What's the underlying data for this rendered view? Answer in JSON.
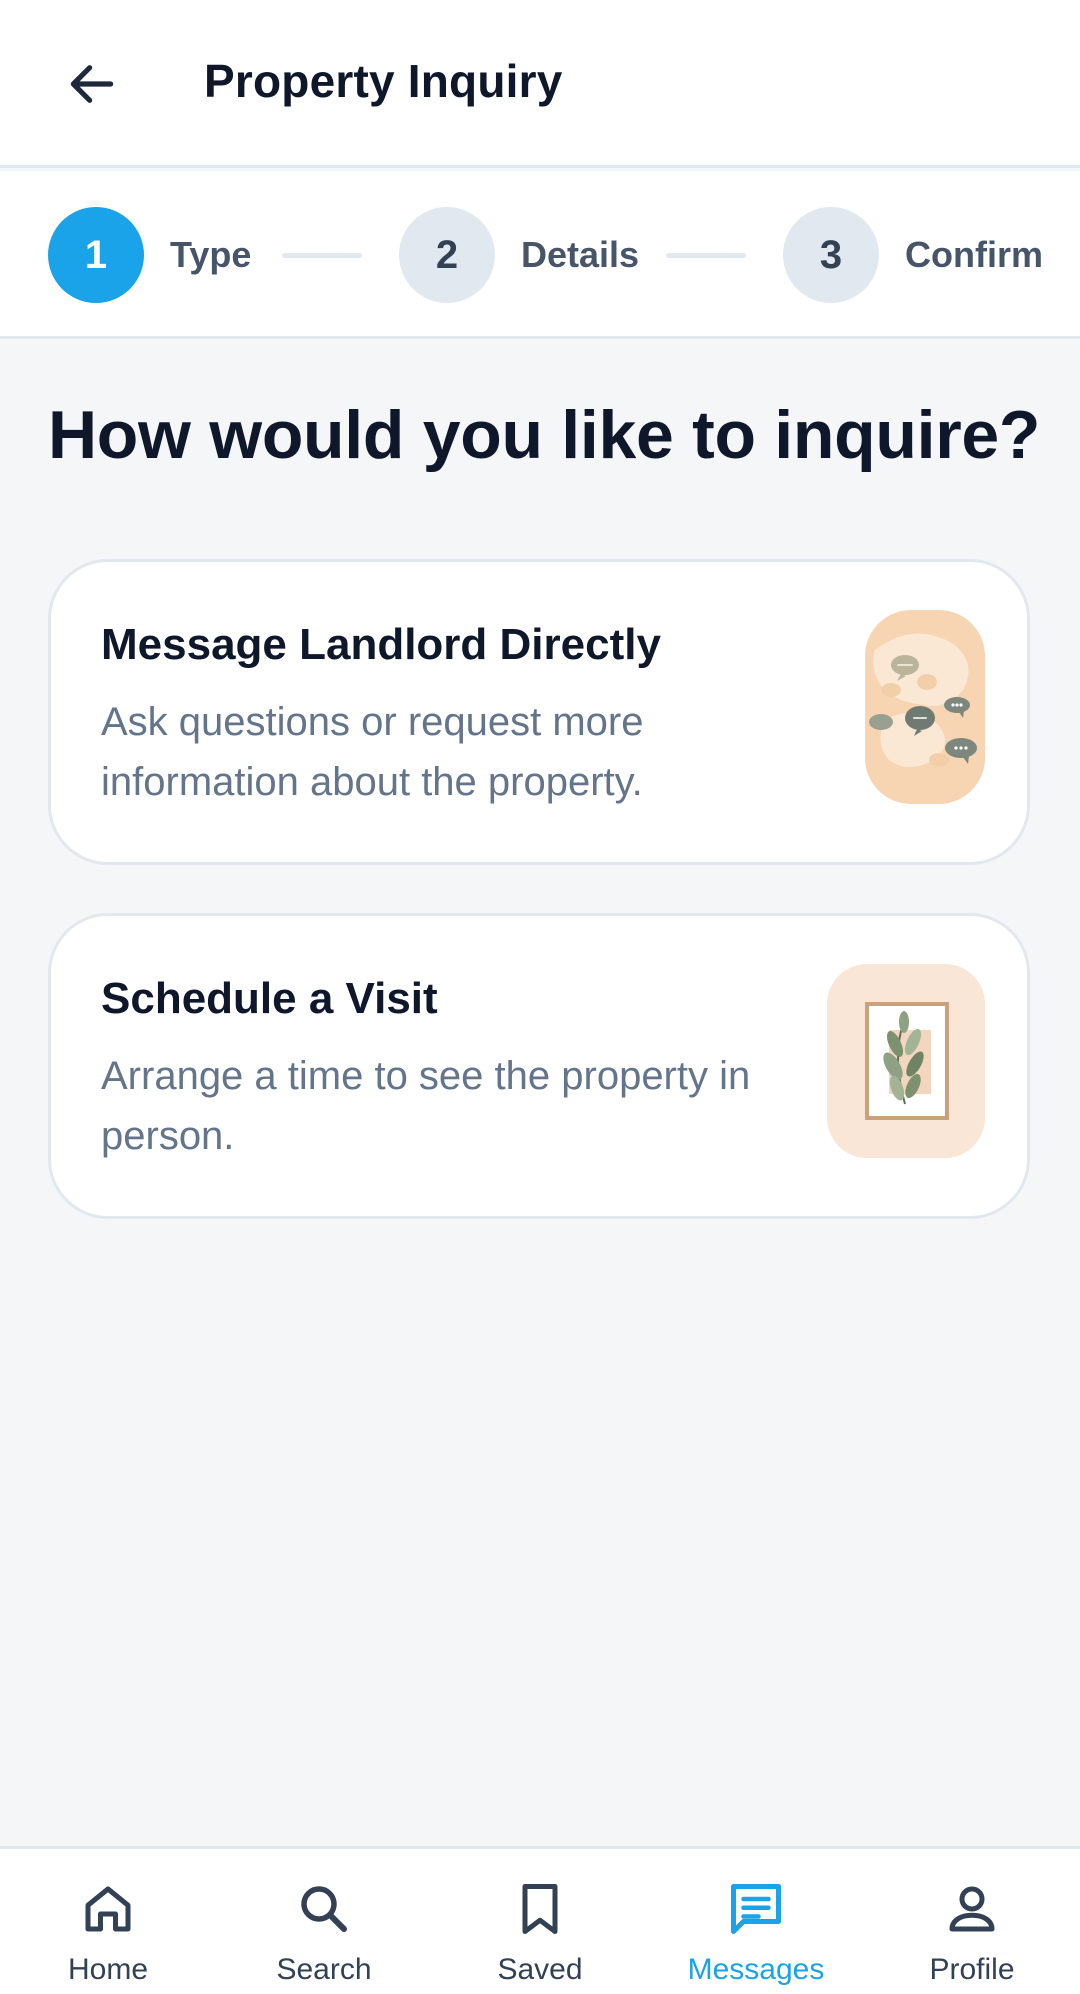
{
  "header": {
    "title": "Property Inquiry",
    "back_icon": "arrow-left-icon"
  },
  "stepper": {
    "steps": [
      {
        "number": "1",
        "label": "Type",
        "state": "active"
      },
      {
        "number": "2",
        "label": "Details",
        "state": "inactive"
      },
      {
        "number": "3",
        "label": "Confirm",
        "state": "inactive"
      }
    ]
  },
  "main": {
    "question": "How would you like to inquire?",
    "options": [
      {
        "title": "Message Landlord Directly",
        "description": "Ask questions or request more information about the property.",
        "icon": "chat-bubbles-illustration"
      },
      {
        "title": "Schedule a Visit",
        "description": "Arrange a time to see the property in person.",
        "icon": "framed-plant-illustration"
      }
    ]
  },
  "bottom_nav": {
    "items": [
      {
        "label": "Home",
        "icon": "home-icon",
        "active": false
      },
      {
        "label": "Search",
        "icon": "search-icon",
        "active": false
      },
      {
        "label": "Saved",
        "icon": "bookmark-icon",
        "active": false
      },
      {
        "label": "Messages",
        "icon": "messages-icon",
        "active": true
      },
      {
        "label": "Profile",
        "icon": "profile-icon",
        "active": false
      }
    ]
  },
  "colors": {
    "accent": "#1aa3e8",
    "text_primary": "#0f172a",
    "text_secondary": "#64748b",
    "background": "#f4f6f8"
  }
}
